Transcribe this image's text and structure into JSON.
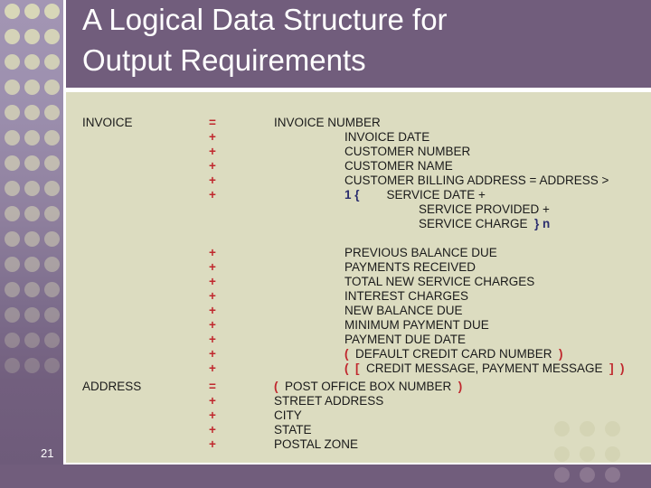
{
  "slide": {
    "title": "A Logical Data Structure for\nOutput Requirements",
    "page_number": "21",
    "colors": {
      "band_purple": "#715d7c",
      "content_bg": "#dcdcc0",
      "sidebar_top": "#a396b4",
      "sidebar_bottom": "#6d5a79",
      "text": "#1a1a1a",
      "operator_red": "#c0272d",
      "repeat_navy": "#2b2e6e",
      "title_white": "#ffffff"
    }
  },
  "structure": {
    "groups": [
      {
        "name": "INVOICE",
        "operator": "=",
        "rows": [
          {
            "op": "",
            "indent": 1,
            "text": "INVOICE NUMBER"
          },
          {
            "op": "+",
            "indent": 2,
            "text": "INVOICE DATE"
          },
          {
            "op": "+",
            "indent": 2,
            "text": "CUSTOMER NUMBER"
          },
          {
            "op": "+",
            "indent": 2,
            "text": "CUSTOMER NAME"
          },
          {
            "op": "+",
            "indent": 2,
            "text": "CUSTOMER BILLING ADDRESS = ADDRESS >"
          },
          {
            "op": "+",
            "indent": 2,
            "pre_repeat": "1 {",
            "text": "SERVICE DATE +"
          },
          {
            "op": "",
            "indent": 3,
            "text": "SERVICE PROVIDED +"
          },
          {
            "op": "",
            "indent": 3,
            "text": "SERVICE CHARGE",
            "post_repeat": "} n"
          },
          {
            "op": "",
            "indent": 1,
            "text": ""
          },
          {
            "op": "+",
            "indent": 2,
            "text": "PREVIOUS BALANCE DUE"
          },
          {
            "op": "+",
            "indent": 2,
            "text": "PAYMENTS RECEIVED"
          },
          {
            "op": "+",
            "indent": 2,
            "text": "TOTAL NEW SERVICE CHARGES"
          },
          {
            "op": "+",
            "indent": 2,
            "text": "INTEREST CHARGES"
          },
          {
            "op": "+",
            "indent": 2,
            "text": "NEW BALANCE DUE"
          },
          {
            "op": "+",
            "indent": 2,
            "text": "MINIMUM PAYMENT DUE"
          },
          {
            "op": "+",
            "indent": 2,
            "text": "PAYMENT DUE DATE"
          },
          {
            "op": "+",
            "indent": 2,
            "open_paren": "(",
            "text": "DEFAULT CREDIT CARD NUMBER",
            "close_paren": ")"
          },
          {
            "op": "+",
            "indent": 2,
            "open_paren": "(  [",
            "text": "CREDIT MESSAGE, PAYMENT MESSAGE",
            "close_paren": "]  )"
          }
        ]
      },
      {
        "name": "ADDRESS",
        "operator": "=",
        "rows": [
          {
            "op": "",
            "indent": 1,
            "open_paren": "(",
            "text": "POST OFFICE BOX NUMBER",
            "close_paren": ")"
          },
          {
            "op": "+",
            "indent": 1,
            "text": "STREET ADDRESS"
          },
          {
            "op": "+",
            "indent": 1,
            "text": "CITY"
          },
          {
            "op": "+",
            "indent": 1,
            "text": "STATE"
          },
          {
            "op": "+",
            "indent": 1,
            "text": "POSTAL ZONE"
          }
        ]
      }
    ]
  }
}
